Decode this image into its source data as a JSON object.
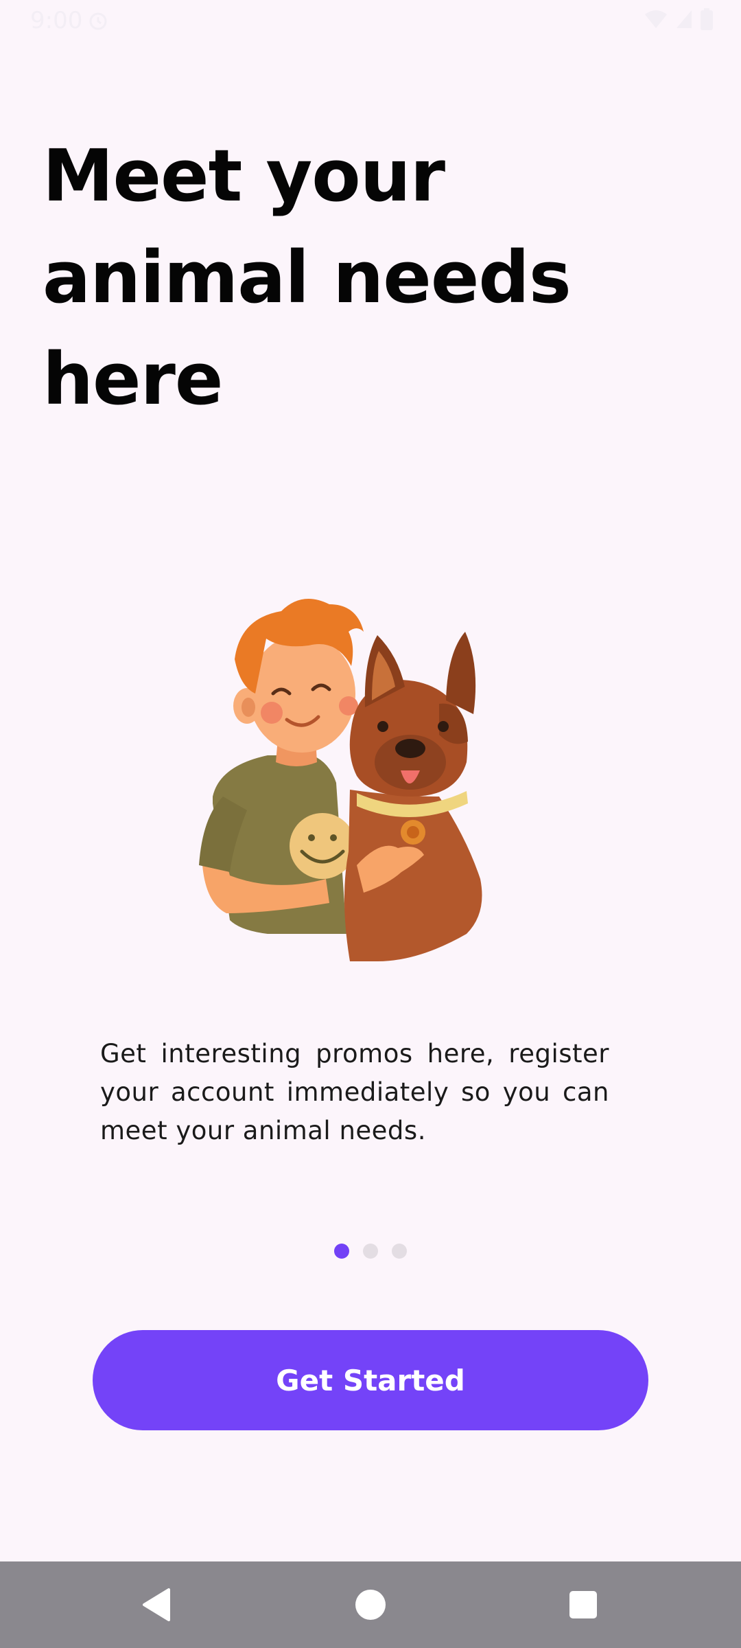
{
  "status_bar": {
    "time": "9:00"
  },
  "headline": {
    "line1": "Meet your",
    "line2": "animal needs",
    "line3": "here"
  },
  "description": "Get interesting promos here, register your account immediately so you can meet your animal needs.",
  "pagination": {
    "total": 3,
    "active_index": 0
  },
  "cta_label": "Get Started",
  "colors": {
    "accent": "#7443f8",
    "background": "#fcf5fb",
    "nav_bar": "#8a888e"
  },
  "icons": {
    "status": [
      "clock-icon",
      "wifi-icon",
      "signal-icon",
      "battery-icon"
    ],
    "nav": [
      "back-icon",
      "home-icon",
      "recents-icon"
    ]
  }
}
